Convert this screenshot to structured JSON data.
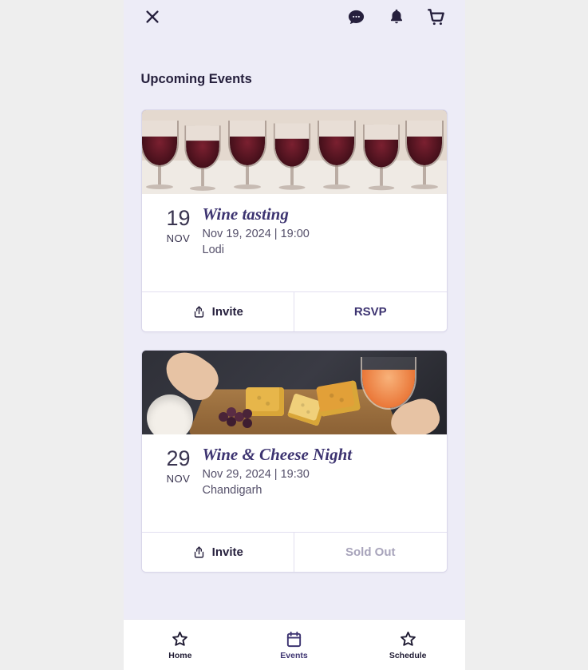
{
  "header": {
    "icons": {
      "close": "close-icon",
      "chat": "chat-icon",
      "bell": "bell-icon",
      "cart": "cart-icon"
    }
  },
  "section_title": "Upcoming Events",
  "events": [
    {
      "day": "19",
      "month": "NOV",
      "title": "Wine tasting",
      "datetime": "Nov 19, 2024 | 19:00",
      "location": "Lodi",
      "invite_label": "Invite",
      "cta_label": "RSVP",
      "cta_state": "rsvp",
      "image_kind": "wine"
    },
    {
      "day": "29",
      "month": "NOV",
      "title": "Wine & Cheese Night",
      "datetime": "Nov 29, 2024 | 19:30",
      "location": "Chandigarh",
      "invite_label": "Invite",
      "cta_label": "Sold Out",
      "cta_state": "soldout",
      "image_kind": "cheese"
    }
  ],
  "nav": {
    "items": [
      {
        "label": "Home",
        "icon": "star",
        "active": false
      },
      {
        "label": "Events",
        "icon": "calendar",
        "active": true
      },
      {
        "label": "Schedule",
        "icon": "star",
        "active": false
      }
    ]
  },
  "colors": {
    "accent": "#3d3471",
    "bg": "#edecf7",
    "muted": "#a8a4bb"
  }
}
